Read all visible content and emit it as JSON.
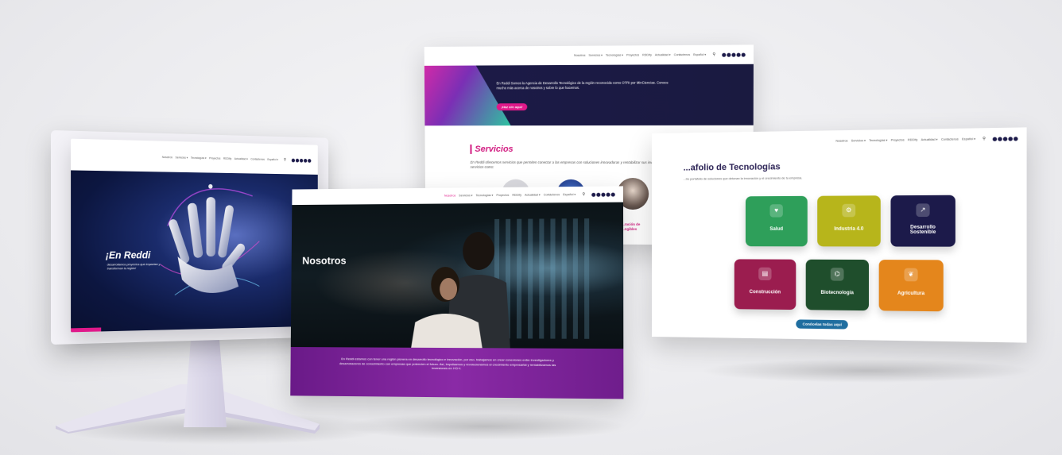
{
  "nav": {
    "items": [
      "Nosotros",
      "Servicios ▾",
      "Tecnologías ▾",
      "Proyectos",
      "RDDIfy",
      "Actualidad ▾",
      "Contáctenos",
      "Español ▾"
    ]
  },
  "logo": {
    "text": "reddi"
  },
  "monitor": {
    "hero_title": "¡En Reddi",
    "hero_subtitle": "desarrollamos proyectos que impactan y transforman la región!"
  },
  "nosotros": {
    "title": "Nosotros",
    "footer_text": "En Reddi estamos con tener una región pionera en desarrollo tecnológico e innovación, por eso, trabajamos en crear conexiones entre investigadores y desarrolladores de conocimiento con empresas que potencien el futuro. Así, impulsamos y revolucionamos el crecimiento empresarial y rentabilizamos las inversiones en I+D+i."
  },
  "servicios": {
    "banner_text": "En Reddi Somos la Agencia de Desarrollo Tecnológico de la región reconocida como OTRI por MinCiencias. Conoce mucho más acerca de nosotros y sobre lo que hacemos.",
    "banner_button": "¡Haz clic aquí!",
    "title": "Servicios",
    "description": "En Reddi ofrecemos servicios que permiten conectar a las empresas con soluciones innovadoras y rentabilizar sus inversiones. Por eso ofrecemos servicios como:",
    "caption": "...ración de ...ngibles"
  },
  "portafolio": {
    "title": "...afolio de Tecnologías",
    "description": "...tro portafolio de soluciones que detonan la innovación y el crecimiento de tu empresa.",
    "tiles": [
      {
        "label": "Salud",
        "color": "#2e9f5a",
        "icon": "heart-pulse-icon"
      },
      {
        "label": "Industria 4.0",
        "color": "#b7b51b",
        "icon": "gear-hand-icon"
      },
      {
        "label": "Desarrollo Sostenible",
        "color": "#1c1a4a",
        "icon": "chart-leaf-icon"
      },
      {
        "label": "Construcción",
        "color": "#9b1d4f",
        "icon": "building-icon"
      },
      {
        "label": "Biotecnología",
        "color": "#1f4e2c",
        "icon": "dna-icon"
      },
      {
        "label": "Agricultura",
        "color": "#e4861c",
        "icon": "plant-icon"
      }
    ],
    "button": "Conócelas todas aquí"
  },
  "colors": {
    "brand_magenta": "#e0198a",
    "brand_purple": "#6a1a88",
    "brand_navy": "#1c1a48"
  }
}
